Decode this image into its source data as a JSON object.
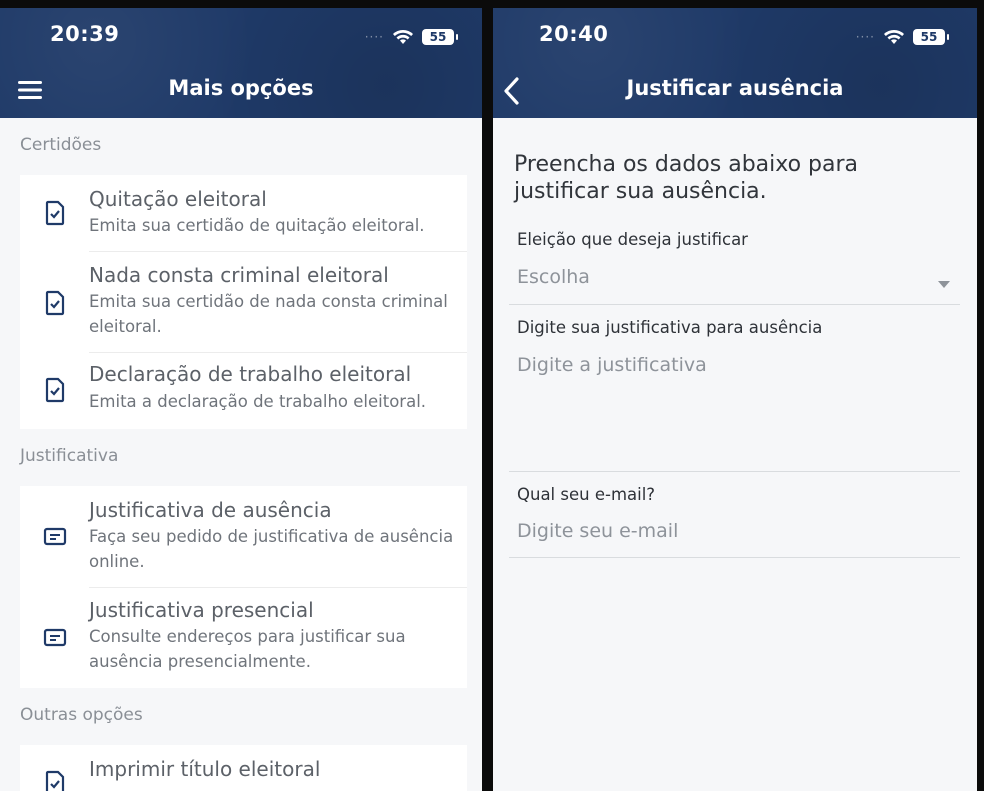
{
  "left": {
    "status": {
      "time": "20:39",
      "battery": "55"
    },
    "nav_title": "Mais opções",
    "sections": {
      "certidoes": {
        "label": "Certidões",
        "items": [
          {
            "title": "Quitação eleitoral",
            "subtitle": "Emita sua certidão de quitação eleitoral."
          },
          {
            "title": "Nada consta criminal eleitoral",
            "subtitle": "Emita sua certidão de nada consta criminal eleitoral."
          },
          {
            "title": "Declaração de trabalho eleitoral",
            "subtitle": "Emita a declaração de trabalho eleitoral."
          }
        ]
      },
      "justificativa": {
        "label": "Justificativa",
        "items": [
          {
            "title": "Justificativa de ausência",
            "subtitle": "Faça seu pedido de justificativa de ausência online."
          },
          {
            "title": "Justificativa presencial",
            "subtitle": "Consulte endereços para justificar sua ausência presencialmente."
          }
        ]
      },
      "outras": {
        "label": "Outras opções",
        "items": [
          {
            "title": "Imprimir título eleitoral"
          }
        ]
      }
    }
  },
  "right": {
    "status": {
      "time": "20:40",
      "battery": "55"
    },
    "nav_title": "Justificar ausência",
    "intro": "Preencha os dados abaixo para justificar sua ausência.",
    "fields": {
      "eleicao": {
        "label": "Eleição que deseja justificar",
        "placeholder": "Escolha"
      },
      "justificativa": {
        "label": "Digite sua justificativa para ausência",
        "placeholder": "Digite a justificativa"
      },
      "email": {
        "label": "Qual seu e-mail?",
        "placeholder": "Digite seu e-mail"
      }
    }
  },
  "colors": {
    "header": "#1f3a68",
    "background": "#f6f7f9",
    "card": "#ffffff",
    "icon": "#1f3a68"
  }
}
